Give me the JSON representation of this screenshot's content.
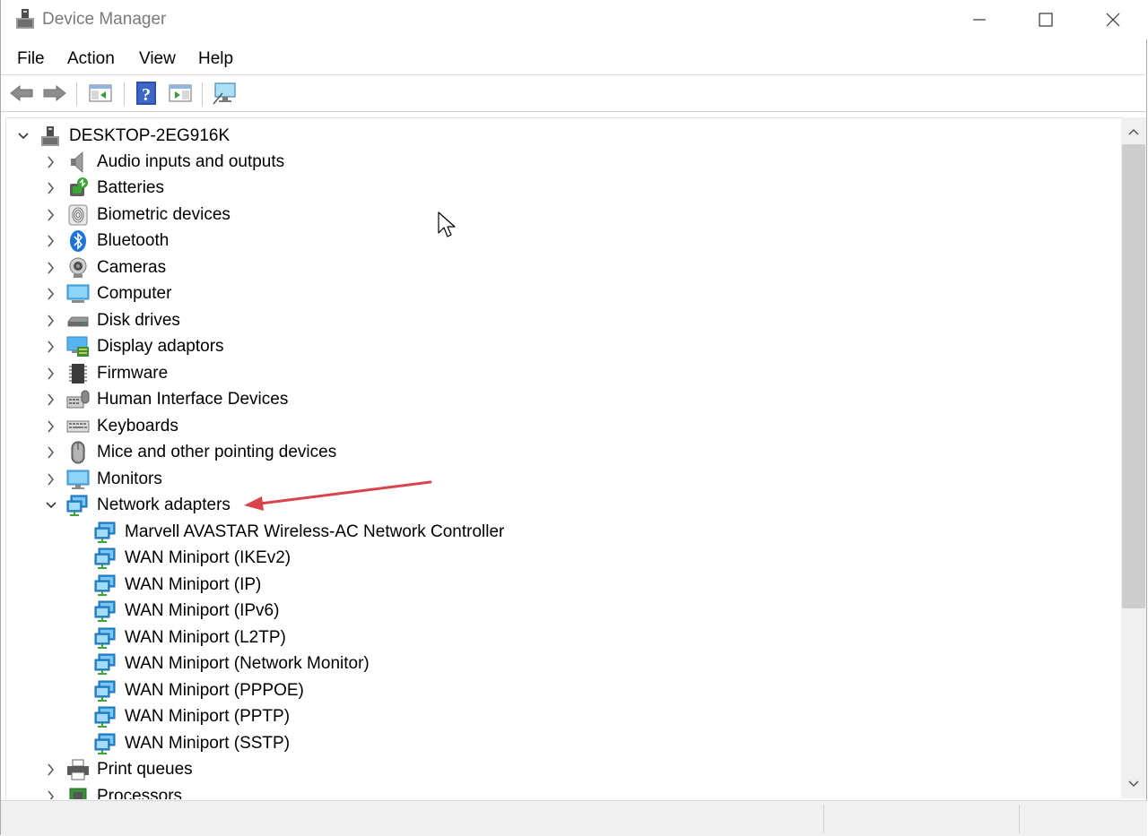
{
  "window": {
    "title": "Device Manager",
    "controls": [
      "minimize",
      "maximize",
      "close"
    ]
  },
  "menu": [
    "File",
    "Action",
    "View",
    "Help"
  ],
  "toolbar": {
    "buttons": [
      "back-icon",
      "forward-icon",
      "show-hide-console-tree-icon",
      "help-icon",
      "properties-icon",
      "scan-hardware-changes-icon"
    ]
  },
  "tree": {
    "root": "DESKTOP-2EG916K",
    "categories": [
      {
        "label": "Audio inputs and outputs",
        "icon": "speaker-icon",
        "expanded": false
      },
      {
        "label": "Batteries",
        "icon": "battery-icon",
        "expanded": false
      },
      {
        "label": "Biometric devices",
        "icon": "fingerprint-icon",
        "expanded": false
      },
      {
        "label": "Bluetooth",
        "icon": "bluetooth-icon",
        "expanded": false
      },
      {
        "label": "Cameras",
        "icon": "camera-icon",
        "expanded": false
      },
      {
        "label": "Computer",
        "icon": "computer-icon",
        "expanded": false
      },
      {
        "label": "Disk drives",
        "icon": "disk-drive-icon",
        "expanded": false
      },
      {
        "label": "Display adaptors",
        "icon": "display-adapter-icon",
        "expanded": false
      },
      {
        "label": "Firmware",
        "icon": "firmware-chip-icon",
        "expanded": false
      },
      {
        "label": "Human Interface Devices",
        "icon": "hid-icon",
        "expanded": false
      },
      {
        "label": "Keyboards",
        "icon": "keyboard-icon",
        "expanded": false
      },
      {
        "label": "Mice and other pointing devices",
        "icon": "mouse-icon",
        "expanded": false
      },
      {
        "label": "Monitors",
        "icon": "monitor-icon",
        "expanded": false
      },
      {
        "label": "Network adapters",
        "icon": "network-adapter-icon",
        "expanded": true,
        "children": [
          "Marvell AVASTAR Wireless-AC Network Controller",
          "WAN Miniport (IKEv2)",
          "WAN Miniport (IP)",
          "WAN Miniport (IPv6)",
          "WAN Miniport (L2TP)",
          "WAN Miniport (Network Monitor)",
          "WAN Miniport (PPPOE)",
          "WAN Miniport (PPTP)",
          "WAN Miniport (SSTP)"
        ]
      },
      {
        "label": "Print queues",
        "icon": "printer-icon",
        "expanded": false
      },
      {
        "label": "Processors",
        "icon": "processor-icon",
        "expanded": false
      }
    ]
  },
  "colors": {
    "annotation_arrow": "#d9444a",
    "network_icon": "#2b8fd8",
    "network_icon_cable": "#3aa635"
  }
}
